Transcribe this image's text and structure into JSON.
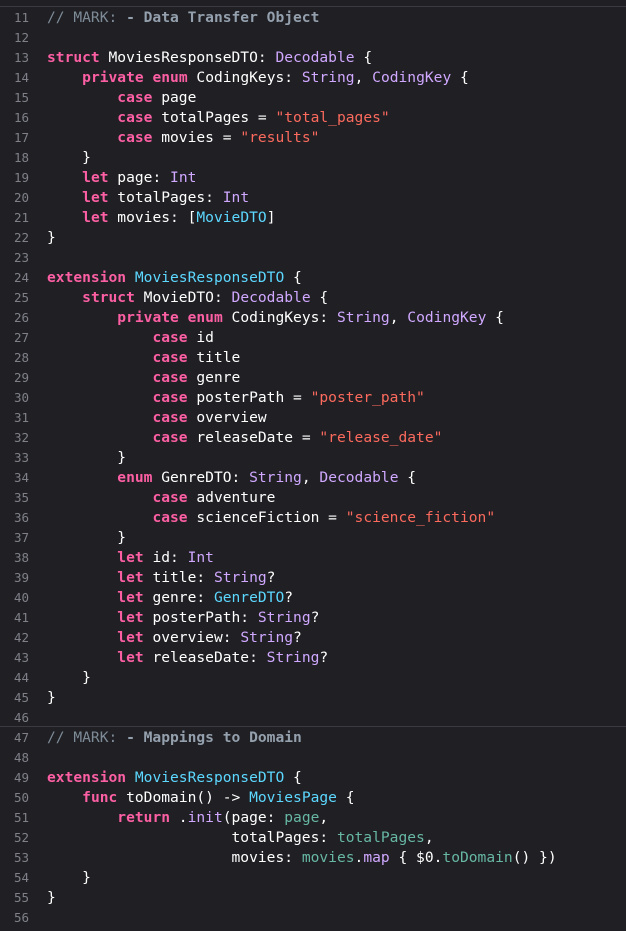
{
  "colors": {
    "background": "#1f1f24",
    "keyword": "#fc5fa3",
    "type": "#d0a8ff",
    "user_type": "#5dd8ff",
    "string": "#fc6a5d",
    "comment": "#7f8c98",
    "line_number": "#7f8088",
    "plain": "#ffffff"
  },
  "lines": [
    {
      "n": "11",
      "mark": true,
      "tokens": [
        [
          "com",
          "// MARK: "
        ],
        [
          "mark",
          "- Data Transfer Object"
        ]
      ]
    },
    {
      "n": "12",
      "tokens": []
    },
    {
      "n": "13",
      "tokens": [
        [
          "kw",
          "struct"
        ],
        [
          "plain",
          " MoviesResponseDTO: "
        ],
        [
          "type",
          "Decodable"
        ],
        [
          "plain",
          " {"
        ]
      ]
    },
    {
      "n": "14",
      "tokens": [
        [
          "plain",
          "    "
        ],
        [
          "kw",
          "private"
        ],
        [
          "plain",
          " "
        ],
        [
          "kw",
          "enum"
        ],
        [
          "plain",
          " CodingKeys: "
        ],
        [
          "type",
          "String"
        ],
        [
          "plain",
          ", "
        ],
        [
          "type",
          "CodingKey"
        ],
        [
          "plain",
          " {"
        ]
      ]
    },
    {
      "n": "15",
      "tokens": [
        [
          "plain",
          "        "
        ],
        [
          "kw",
          "case"
        ],
        [
          "plain",
          " page"
        ]
      ]
    },
    {
      "n": "16",
      "tokens": [
        [
          "plain",
          "        "
        ],
        [
          "kw",
          "case"
        ],
        [
          "plain",
          " totalPages = "
        ],
        [
          "str",
          "\"total_pages\""
        ]
      ]
    },
    {
      "n": "17",
      "tokens": [
        [
          "plain",
          "        "
        ],
        [
          "kw",
          "case"
        ],
        [
          "plain",
          " movies = "
        ],
        [
          "str",
          "\"results\""
        ]
      ]
    },
    {
      "n": "18",
      "tokens": [
        [
          "plain",
          "    }"
        ]
      ]
    },
    {
      "n": "19",
      "tokens": [
        [
          "plain",
          "    "
        ],
        [
          "kw",
          "let"
        ],
        [
          "plain",
          " page: "
        ],
        [
          "type",
          "Int"
        ]
      ]
    },
    {
      "n": "20",
      "tokens": [
        [
          "plain",
          "    "
        ],
        [
          "kw",
          "let"
        ],
        [
          "plain",
          " totalPages: "
        ],
        [
          "type",
          "Int"
        ]
      ]
    },
    {
      "n": "21",
      "tokens": [
        [
          "plain",
          "    "
        ],
        [
          "kw",
          "let"
        ],
        [
          "plain",
          " movies: ["
        ],
        [
          "user",
          "MovieDTO"
        ],
        [
          "plain",
          "]"
        ]
      ]
    },
    {
      "n": "22",
      "tokens": [
        [
          "plain",
          "}"
        ]
      ]
    },
    {
      "n": "23",
      "tokens": []
    },
    {
      "n": "24",
      "tokens": [
        [
          "kw",
          "extension"
        ],
        [
          "plain",
          " "
        ],
        [
          "user",
          "MoviesResponseDTO"
        ],
        [
          "plain",
          " {"
        ]
      ]
    },
    {
      "n": "25",
      "tokens": [
        [
          "plain",
          "    "
        ],
        [
          "kw",
          "struct"
        ],
        [
          "plain",
          " MovieDTO: "
        ],
        [
          "type",
          "Decodable"
        ],
        [
          "plain",
          " {"
        ]
      ]
    },
    {
      "n": "26",
      "tokens": [
        [
          "plain",
          "        "
        ],
        [
          "kw",
          "private"
        ],
        [
          "plain",
          " "
        ],
        [
          "kw",
          "enum"
        ],
        [
          "plain",
          " CodingKeys: "
        ],
        [
          "type",
          "String"
        ],
        [
          "plain",
          ", "
        ],
        [
          "type",
          "CodingKey"
        ],
        [
          "plain",
          " {"
        ]
      ]
    },
    {
      "n": "27",
      "tokens": [
        [
          "plain",
          "            "
        ],
        [
          "kw",
          "case"
        ],
        [
          "plain",
          " id"
        ]
      ]
    },
    {
      "n": "28",
      "tokens": [
        [
          "plain",
          "            "
        ],
        [
          "kw",
          "case"
        ],
        [
          "plain",
          " title"
        ]
      ]
    },
    {
      "n": "29",
      "tokens": [
        [
          "plain",
          "            "
        ],
        [
          "kw",
          "case"
        ],
        [
          "plain",
          " genre"
        ]
      ]
    },
    {
      "n": "30",
      "tokens": [
        [
          "plain",
          "            "
        ],
        [
          "kw",
          "case"
        ],
        [
          "plain",
          " posterPath = "
        ],
        [
          "str",
          "\"poster_path\""
        ]
      ]
    },
    {
      "n": "31",
      "tokens": [
        [
          "plain",
          "            "
        ],
        [
          "kw",
          "case"
        ],
        [
          "plain",
          " overview"
        ]
      ]
    },
    {
      "n": "32",
      "tokens": [
        [
          "plain",
          "            "
        ],
        [
          "kw",
          "case"
        ],
        [
          "plain",
          " releaseDate = "
        ],
        [
          "str",
          "\"release_date\""
        ]
      ]
    },
    {
      "n": "33",
      "tokens": [
        [
          "plain",
          "        }"
        ]
      ]
    },
    {
      "n": "34",
      "tokens": [
        [
          "plain",
          "        "
        ],
        [
          "kw",
          "enum"
        ],
        [
          "plain",
          " GenreDTO: "
        ],
        [
          "type",
          "String"
        ],
        [
          "plain",
          ", "
        ],
        [
          "type",
          "Decodable"
        ],
        [
          "plain",
          " {"
        ]
      ]
    },
    {
      "n": "35",
      "tokens": [
        [
          "plain",
          "            "
        ],
        [
          "kw",
          "case"
        ],
        [
          "plain",
          " adventure"
        ]
      ]
    },
    {
      "n": "36",
      "tokens": [
        [
          "plain",
          "            "
        ],
        [
          "kw",
          "case"
        ],
        [
          "plain",
          " scienceFiction = "
        ],
        [
          "str",
          "\"science_fiction\""
        ]
      ]
    },
    {
      "n": "37",
      "tokens": [
        [
          "plain",
          "        }"
        ]
      ]
    },
    {
      "n": "38",
      "tokens": [
        [
          "plain",
          "        "
        ],
        [
          "kw",
          "let"
        ],
        [
          "plain",
          " id: "
        ],
        [
          "type",
          "Int"
        ]
      ]
    },
    {
      "n": "39",
      "tokens": [
        [
          "plain",
          "        "
        ],
        [
          "kw",
          "let"
        ],
        [
          "plain",
          " title: "
        ],
        [
          "type",
          "String"
        ],
        [
          "plain",
          "?"
        ]
      ]
    },
    {
      "n": "40",
      "tokens": [
        [
          "plain",
          "        "
        ],
        [
          "kw",
          "let"
        ],
        [
          "plain",
          " genre: "
        ],
        [
          "user",
          "GenreDTO"
        ],
        [
          "plain",
          "?"
        ]
      ]
    },
    {
      "n": "41",
      "tokens": [
        [
          "plain",
          "        "
        ],
        [
          "kw",
          "let"
        ],
        [
          "plain",
          " posterPath: "
        ],
        [
          "type",
          "String"
        ],
        [
          "plain",
          "?"
        ]
      ]
    },
    {
      "n": "42",
      "tokens": [
        [
          "plain",
          "        "
        ],
        [
          "kw",
          "let"
        ],
        [
          "plain",
          " overview: "
        ],
        [
          "type",
          "String"
        ],
        [
          "plain",
          "?"
        ]
      ]
    },
    {
      "n": "43",
      "tokens": [
        [
          "plain",
          "        "
        ],
        [
          "kw",
          "let"
        ],
        [
          "plain",
          " releaseDate: "
        ],
        [
          "type",
          "String"
        ],
        [
          "plain",
          "?"
        ]
      ]
    },
    {
      "n": "44",
      "tokens": [
        [
          "plain",
          "    }"
        ]
      ]
    },
    {
      "n": "45",
      "tokens": [
        [
          "plain",
          "}"
        ]
      ]
    },
    {
      "n": "46",
      "tokens": []
    },
    {
      "n": "47",
      "mark": true,
      "tokens": [
        [
          "com",
          "// MARK: "
        ],
        [
          "mark",
          "- Mappings to Domain"
        ]
      ]
    },
    {
      "n": "48",
      "tokens": []
    },
    {
      "n": "49",
      "tokens": [
        [
          "kw",
          "extension"
        ],
        [
          "plain",
          " "
        ],
        [
          "user",
          "MoviesResponseDTO"
        ],
        [
          "plain",
          " {"
        ]
      ]
    },
    {
      "n": "50",
      "tokens": [
        [
          "plain",
          "    "
        ],
        [
          "kw",
          "func"
        ],
        [
          "plain",
          " toDomain() -> "
        ],
        [
          "user",
          "MoviesPage"
        ],
        [
          "plain",
          " {"
        ]
      ]
    },
    {
      "n": "51",
      "tokens": [
        [
          "plain",
          "        "
        ],
        [
          "kw",
          "return"
        ],
        [
          "plain",
          " ."
        ],
        [
          "type",
          "init"
        ],
        [
          "plain",
          "(page: "
        ],
        [
          "var",
          "page"
        ],
        [
          "plain",
          ","
        ]
      ]
    },
    {
      "n": "52",
      "tokens": [
        [
          "plain",
          "                     totalPages: "
        ],
        [
          "var",
          "totalPages"
        ],
        [
          "plain",
          ","
        ]
      ]
    },
    {
      "n": "53",
      "tokens": [
        [
          "plain",
          "                     movies: "
        ],
        [
          "var",
          "movies"
        ],
        [
          "plain",
          "."
        ],
        [
          "type",
          "map"
        ],
        [
          "plain",
          " { $0."
        ],
        [
          "fn",
          "toDomain"
        ],
        [
          "plain",
          "() })"
        ]
      ]
    },
    {
      "n": "54",
      "tokens": [
        [
          "plain",
          "    }"
        ]
      ]
    },
    {
      "n": "55",
      "tokens": [
        [
          "plain",
          "}"
        ]
      ]
    },
    {
      "n": "56",
      "tokens": []
    }
  ]
}
